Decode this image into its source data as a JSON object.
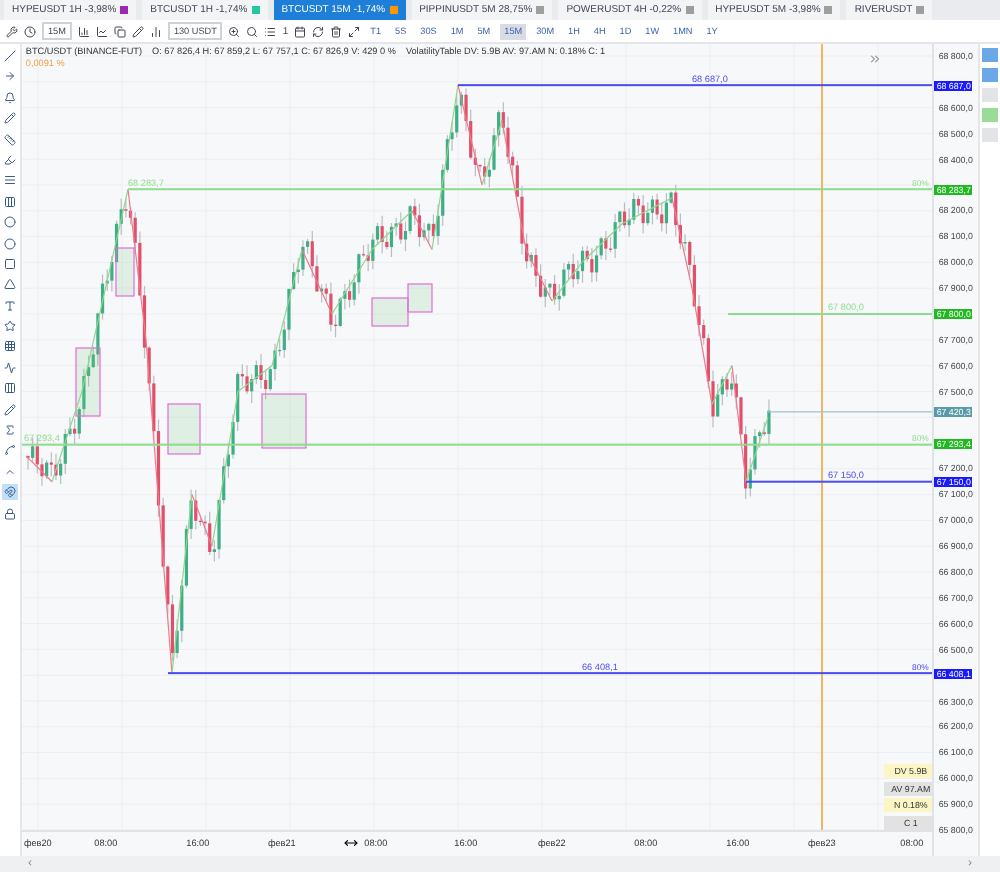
{
  "tabs": [
    {
      "label": "HYPEUSDT 1H -3,98%",
      "color": "#9c27b0",
      "selected": false
    },
    {
      "label": "BTCUSDT 1H -1,74%",
      "color": "#26c6a0",
      "selected": false
    },
    {
      "label": "BTCUSDT 15M -1,74%",
      "color": "#ff9800",
      "selected": true
    },
    {
      "label": "PIPPINUSDT 5M 28,75%",
      "color": "#9e9e9e",
      "selected": false
    },
    {
      "label": "POWERUSDT 4H -0,22%",
      "color": "#9e9e9e",
      "selected": false
    },
    {
      "label": "HYPEUSDT 5M -3,98%",
      "color": "#9e9e9e",
      "selected": false
    },
    {
      "label": "RIVERUSDT",
      "color": "#9e9e9e",
      "selected": false
    }
  ],
  "toolbar": {
    "timeframe": "15M",
    "amount": "130 USDT",
    "count": "1",
    "intervals": [
      {
        "label": "T1",
        "selected": false
      },
      {
        "label": "5S",
        "selected": false
      },
      {
        "label": "30S",
        "selected": false
      },
      {
        "label": "1M",
        "selected": false
      },
      {
        "label": "5M",
        "selected": false
      },
      {
        "label": "15M",
        "selected": true
      },
      {
        "label": "30M",
        "selected": false
      },
      {
        "label": "1H",
        "selected": false
      },
      {
        "label": "4H",
        "selected": false
      },
      {
        "label": "1D",
        "selected": false
      },
      {
        "label": "1W",
        "selected": false
      },
      {
        "label": "1MN",
        "selected": false
      },
      {
        "label": "1Y",
        "selected": false
      }
    ]
  },
  "legend": {
    "symbol": "BTC/USDT (BINANCE-FUT)",
    "ohlc": "O: 67 826,4  H: 67 859,2  L: 67 757,1  C: 67 826,9  V: 429  0 %",
    "indicator": "VolatilityTable  DV: 5.9B AV: 97.AM N: 0.18% C: 1",
    "change": "0,0091 %"
  },
  "tools": [
    {
      "selected": false
    },
    {
      "selected": false
    },
    {
      "selected": false
    },
    {
      "selected": false
    },
    {
      "selected": false
    },
    {
      "selected": false
    },
    {
      "selected": false
    },
    {
      "selected": false
    },
    {
      "selected": false
    },
    {
      "selected": false
    },
    {
      "selected": false
    },
    {
      "selected": false
    },
    {
      "selected": false
    },
    {
      "selected": false
    },
    {
      "selected": false
    },
    {
      "selected": false
    },
    {
      "selected": false
    },
    {
      "selected": false
    },
    {
      "selected": false
    },
    {
      "selected": false
    },
    {
      "selected": false
    },
    {
      "selected": true
    },
    {
      "selected": false
    }
  ],
  "levels": [
    {
      "label": "68 687,0",
      "color": "#4b4bf0"
    },
    {
      "label": "68 283,7",
      "color": "#8fdc8f",
      "end_label": "80%"
    },
    {
      "label": "67 800,0",
      "color": "#8fdc8f"
    },
    {
      "label": "67 293,4",
      "color": "#8fdc8f",
      "end_label": "80%"
    },
    {
      "label": "67 150,0",
      "color": "#4b4bf0"
    },
    {
      "label": "66 408,1",
      "color": "#4b4bf0",
      "end_label": "80%"
    }
  ],
  "price_axis": {
    "ticks": [
      "68 800,0",
      "68 600,0",
      "68 500,0",
      "68 400,0",
      "68 200,0",
      "68 100,0",
      "68 000,0",
      "67 900,0",
      "67 700,0",
      "67 600,0",
      "67 500,0",
      "67 200,0",
      "67 100,0",
      "67 000,0",
      "66 900,0",
      "66 800,0",
      "66 700,0",
      "66 600,0",
      "66 500,0",
      "66 300,0",
      "66 200,0",
      "66 100,0",
      "66 000,0",
      "65 900,0",
      "65 800,0"
    ]
  },
  "price_tags": [
    {
      "text": "68 687,0",
      "color": "#1a1aff"
    },
    {
      "text": "68 283,7",
      "color": "#22b822"
    },
    {
      "text": "67 800,0",
      "color": "#22b822"
    },
    {
      "text": "67 420,3",
      "color": "#5a9aa8"
    },
    {
      "text": "67 293,4",
      "color": "#22b822"
    },
    {
      "text": "67 150,0",
      "color": "#1a1aff"
    },
    {
      "text": "66 408,1",
      "color": "#1a1aff"
    }
  ],
  "stats": [
    {
      "text": "DV 5.9B",
      "color": "#fbf6c4"
    },
    {
      "text": "AV 97.AM",
      "color": "#e2e2e2"
    },
    {
      "text": "N 0.18%",
      "color": "#fbf6c4"
    },
    {
      "text": "C 1",
      "color": "#e2e2e2"
    }
  ],
  "time_axis": [
    "фев20",
    "08:00",
    "16:00",
    "фев21",
    "08:00",
    "16:00",
    "фев22",
    "08:00",
    "16:00",
    "фев23",
    "08:00"
  ],
  "scroll": {
    "left": "‹",
    "right": "›"
  }
}
